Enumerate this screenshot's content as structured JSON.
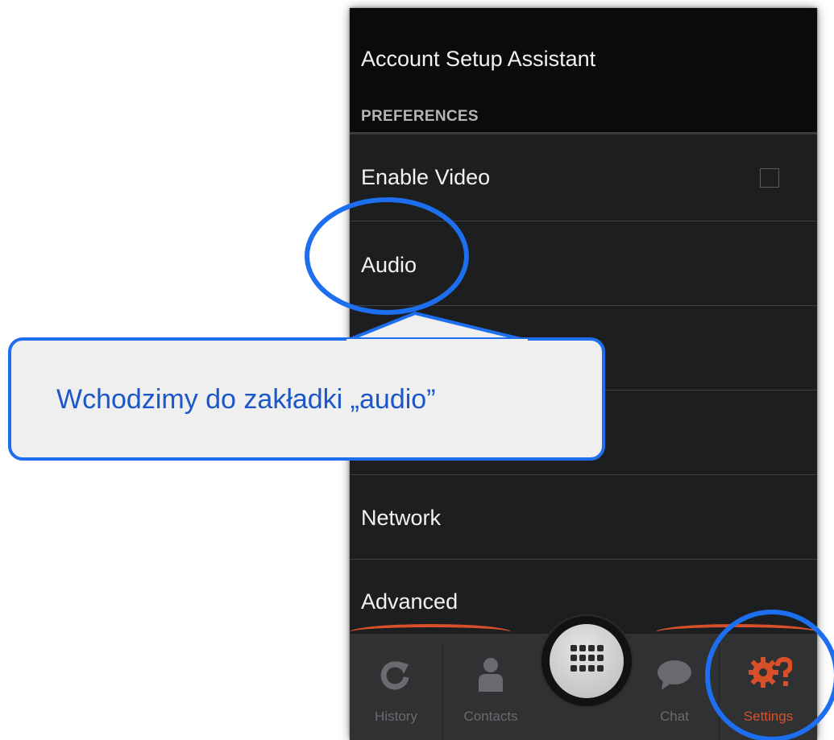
{
  "settings_list": {
    "account_setup": "Account Setup Assistant",
    "section_header": "PREFERENCES",
    "items": [
      {
        "label": "Enable Video"
      },
      {
        "label": "Audio"
      },
      {
        "label": ""
      },
      {
        "label": ""
      },
      {
        "label": "Network"
      },
      {
        "label": "Advanced"
      }
    ],
    "enable_video_checked": false
  },
  "tabbar": {
    "tabs": [
      {
        "label": "History",
        "icon": "refresh-icon"
      },
      {
        "label": "Contacts",
        "icon": "person-icon"
      },
      {
        "label": "",
        "icon": "dialpad-icon"
      },
      {
        "label": "Chat",
        "icon": "chat-bubble-icon"
      },
      {
        "label": "Settings",
        "icon": "gear-question-icon",
        "active": true
      }
    ]
  },
  "callout": {
    "text": "Wchodzimy do zakładki „audio”"
  },
  "colors": {
    "highlight": "#1d6ff0",
    "active_tab": "#d8502a",
    "callout_text": "#1b57c8"
  }
}
